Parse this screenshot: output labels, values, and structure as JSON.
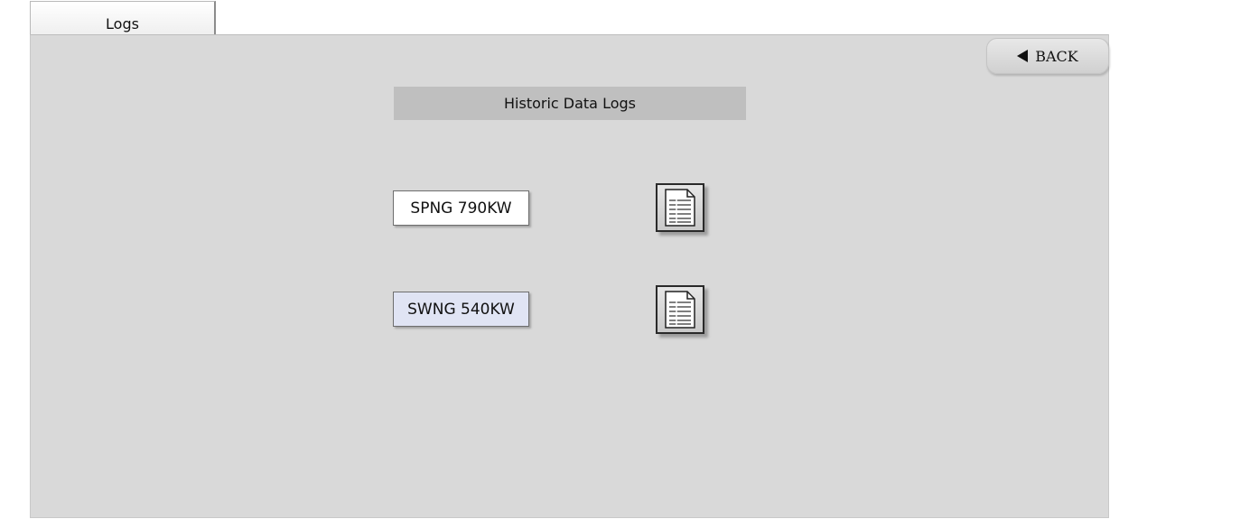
{
  "tab": {
    "label": "Logs"
  },
  "back_button": {
    "label": "BACK"
  },
  "page_title": "Historic Data Logs",
  "logs": [
    {
      "label": "SPNG 790KW",
      "icon": "document-icon"
    },
    {
      "label": "SWNG 540KW",
      "icon": "document-icon"
    }
  ],
  "colors": {
    "panel_bg": "#d9d9d9",
    "title_bar_bg": "#bfbfbf",
    "selected_button_bg": "#e0e4f4"
  }
}
